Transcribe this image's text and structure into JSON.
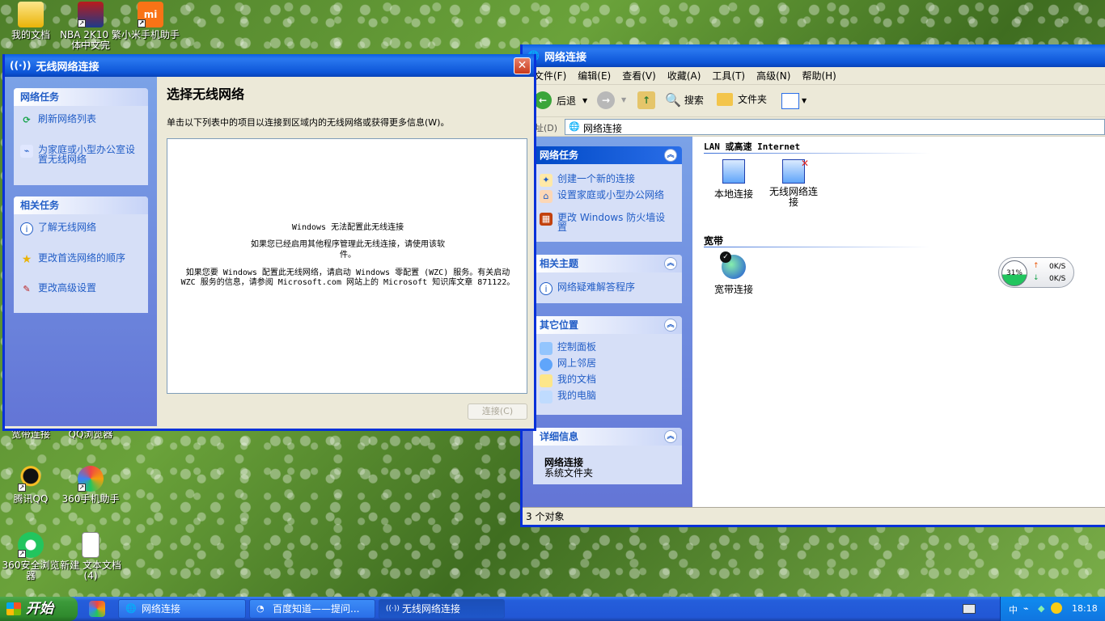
{
  "desktop_icons": [
    {
      "label": "我的文档",
      "icon": "documents-icon"
    },
    {
      "label": "NBA 2K10 繁体中文完",
      "icon": "nba-game-icon"
    },
    {
      "label": "小米手机助手",
      "icon": "xiaomi-icon"
    },
    {
      "label": "宽带连接",
      "icon": "broadband-icon"
    },
    {
      "label": "QQ浏览器",
      "icon": "qq-browser-icon"
    },
    {
      "label": "腾讯QQ",
      "icon": "qq-icon"
    },
    {
      "label": "360手机助手",
      "icon": "360-phone-icon"
    },
    {
      "label": "360安全浏览器",
      "icon": "360-browser-icon"
    },
    {
      "label": "新建 文本文档 (4)",
      "icon": "text-file-icon"
    }
  ],
  "wireless_window": {
    "title": "无线网络连接",
    "network_tasks": {
      "header": "网络任务",
      "items": [
        "刷新网络列表",
        "为家庭或小型办公室设置无线网络"
      ]
    },
    "related_tasks": {
      "header": "相关任务",
      "items": [
        "了解无线网络",
        "更改首选网络的顺序",
        "更改高级设置"
      ]
    },
    "heading": "选择无线网络",
    "description": "单击以下列表中的项目以连接到区域内的无线网络或获得更多信息(W)。",
    "message_1": "Windows 无法配置此无线连接",
    "message_2": "如果您已经启用其他程序管理此无线连接，请使用该软件。",
    "message_3": "如果您要 Windows 配置此无线网络，请启动 Windows 零配置 (WZC) 服务。有关启动 WZC 服务的信息，请参阅 Microsoft.com 网站上的 Microsoft 知识库文章 871122。",
    "connect_button": "连接(C)"
  },
  "network_window": {
    "title": "网络连接",
    "menu": [
      "文件(F)",
      "编辑(E)",
      "查看(V)",
      "收藏(A)",
      "工具(T)",
      "高级(N)",
      "帮助(H)"
    ],
    "toolbar": {
      "back": "后退",
      "search": "搜索",
      "folders": "文件夹"
    },
    "address_label": "地址(D)",
    "address_value": "网络连接",
    "tasks": {
      "header": "网络任务",
      "items": [
        "创建一个新的连接",
        "设置家庭或小型办公网络",
        "更改 Windows 防火墙设置"
      ]
    },
    "related": {
      "header": "相关主题",
      "items": [
        "网络疑难解答程序"
      ]
    },
    "other": {
      "header": "其它位置",
      "items": [
        "控制面板",
        "网上邻居",
        "我的文档",
        "我的电脑"
      ]
    },
    "details": {
      "header": "详细信息",
      "name": "网络连接",
      "type": "系统文件夹"
    },
    "section_lan": "LAN 或高速 Internet",
    "section_broadband": "宽带",
    "connections": [
      "本地连接",
      "无线网络连接",
      "宽带连接"
    ],
    "status": "3 个对象"
  },
  "speed_widget": {
    "percent": "31%",
    "up": "0K/S",
    "down": "0K/S"
  },
  "taskbar": {
    "start": "开始",
    "items": [
      "网络连接",
      "百度知道——提问...",
      "无线网络连接"
    ],
    "clock": "18:18"
  },
  "colors": {
    "xp_blue": "#0831d9",
    "link_blue": "#215dc6",
    "taskbar": "#245edb",
    "start_green": "#3c9a3a"
  }
}
